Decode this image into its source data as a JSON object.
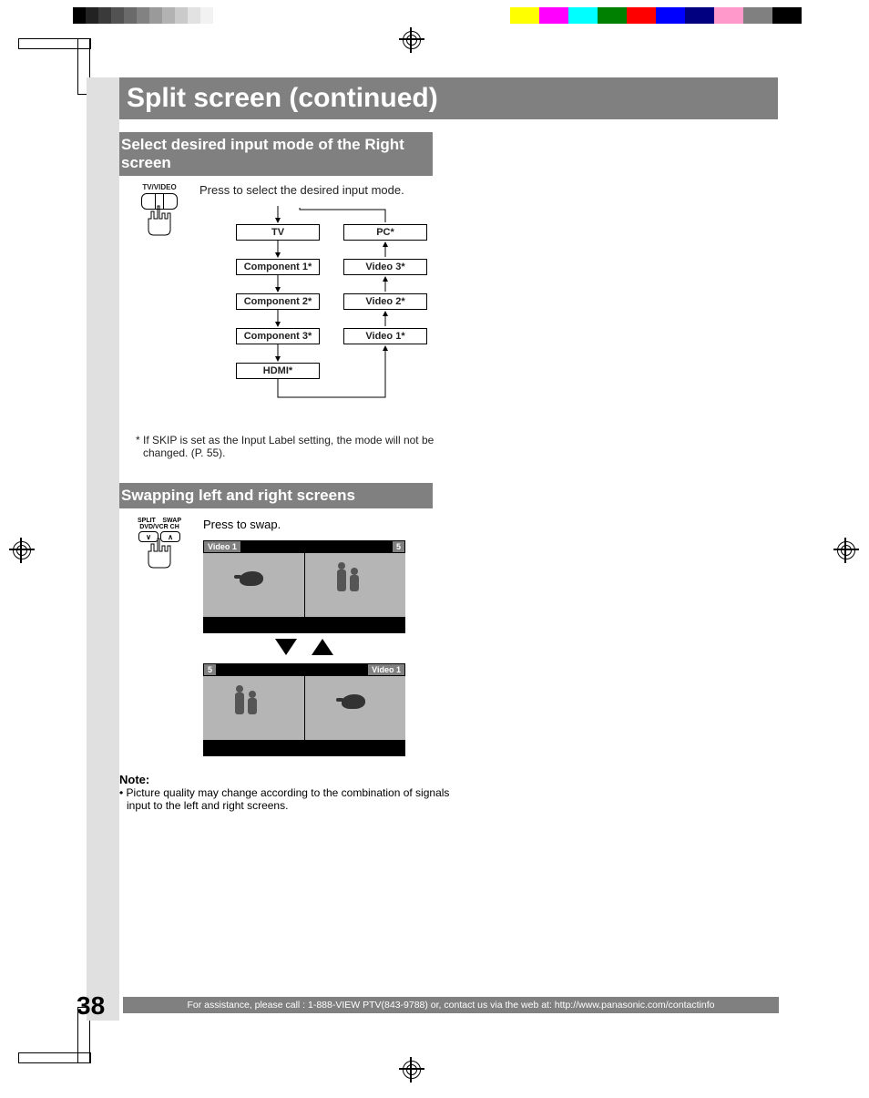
{
  "page": {
    "title": "Split screen (continued)",
    "number": "38",
    "footer": "For assistance, please call : 1-888-VIEW PTV(843-9788) or, contact us via the web at: http://www.panasonic.com/contactinfo"
  },
  "cal_gray_colors": [
    "#000000",
    "#222222",
    "#3a3a3a",
    "#525252",
    "#6a6a6a",
    "#828282",
    "#9a9a9a",
    "#b2b2b2",
    "#cacaca",
    "#e2e2e2",
    "#f2f2f2",
    "#ffffff"
  ],
  "cal_rgb_colors": [
    "#ffff00",
    "#ff00ff",
    "#00ffff",
    "#008000",
    "#ff0000",
    "#0000ff",
    "#000080",
    "#ff99cc",
    "#808080",
    "#000000"
  ],
  "section1": {
    "heading": "Select desired input mode of the Right screen",
    "button_label": "TV/VIDEO",
    "instruction": "Press to select the desired input mode.",
    "flow_left": [
      "TV",
      "Component 1*",
      "Component 2*",
      "Component 3*",
      "HDMI*"
    ],
    "flow_right": [
      "PC*",
      "Video 3*",
      "Video 2*",
      "Video 1*"
    ],
    "footnote": "* If SKIP is set as the Input Label setting, the mode will not be changed. (P. 55)."
  },
  "section2": {
    "heading": "Swapping left and right screens",
    "button_top": "SPLIT",
    "button_top2": "SWAP",
    "button_sub": "DVD/VCR CH",
    "instruction": "Press to swap.",
    "screen_a_left": "Video 1",
    "screen_a_right": "5",
    "screen_b_left": "5",
    "screen_b_right": "Video 1",
    "note_title": "Note:",
    "note_body": "• Picture quality may change according to the combination of signals input to the left and right screens."
  }
}
